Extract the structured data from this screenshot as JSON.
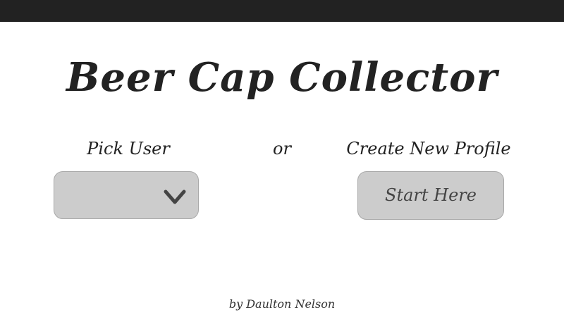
{
  "app": {
    "title": "Beer Cap Collector"
  },
  "pick_user": {
    "label": "Pick User",
    "selected_value": "",
    "dropdown_icon": "chevron-down-icon"
  },
  "separator_text": "or",
  "create_profile": {
    "label": "Create New Profile",
    "button_label": "Start Here"
  },
  "footer": {
    "credit": "by Daulton Nelson"
  },
  "colors": {
    "top_bar": "#222222",
    "background": "#ffffff",
    "control_fill": "#cccccc",
    "control_border": "#a9a9a9",
    "text": "#222222"
  }
}
